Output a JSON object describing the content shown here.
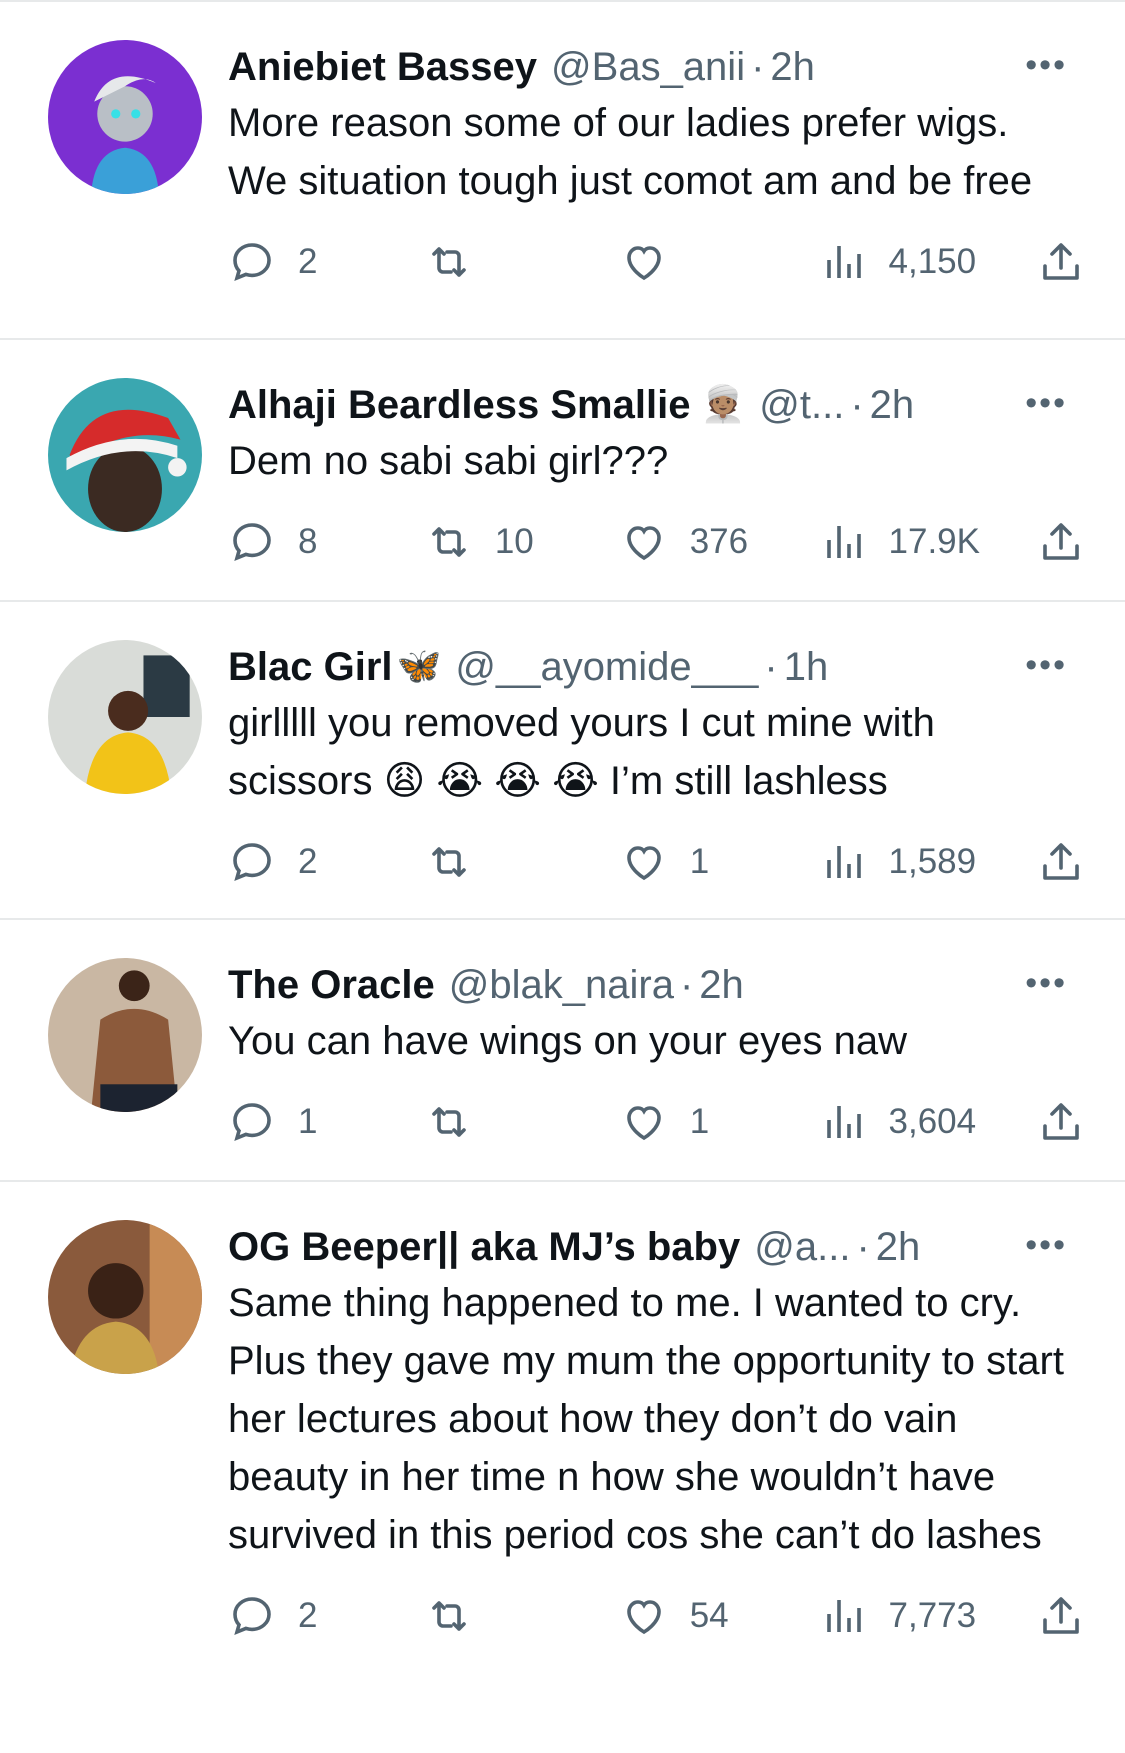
{
  "tweets": [
    {
      "name": "Aniebiet Bassey",
      "emoji": "",
      "handle": "@Bas_anii",
      "time": "2h",
      "text": "More reason some of our ladies prefer wigs. We situation tough just comot am and be free",
      "replies": "2",
      "retweets": "",
      "likes": "",
      "views": "4,150",
      "avatar_bg": "#7b2fd1"
    },
    {
      "name": "Alhaji Beardless Smallie",
      "emoji": "👳🏽",
      "handle": "@t...",
      "time": "2h",
      "text": "Dem no sabi sabi girl???",
      "replies": "8",
      "retweets": "10",
      "likes": "376",
      "views": "17.9K",
      "avatar_bg": "#3aa7b0"
    },
    {
      "name": "Blac Girl",
      "emoji": "🦋",
      "handle": "@__ayomide___",
      "time": "1h",
      "text": "girlllll you removed yours I cut mine with scissors 😩 😭 😭 😭 I’m still lashless",
      "replies": "2",
      "retweets": "",
      "likes": "1",
      "views": "1,589",
      "avatar_bg": "#c9a23a"
    },
    {
      "name": "The Oracle",
      "emoji": "",
      "handle": "@blak_naira",
      "time": "2h",
      "text": "You can have wings on your eyes naw",
      "replies": "1",
      "retweets": "",
      "likes": "1",
      "views": "3,604",
      "avatar_bg": "#8c6a4f"
    },
    {
      "name": "OG Beeper|| aka MJ’s baby",
      "emoji": "",
      "handle": "@a...",
      "time": "2h",
      "text": "Same thing happened to me. I wanted to cry. Plus they gave my mum the opportunity to start her lectures about how they don’t do vain beauty in her time n how she wouldn’t have survived in this period cos she can’t do lashes",
      "replies": "2",
      "retweets": "",
      "likes": "54",
      "views": "7,773",
      "avatar_bg": "#6b4a35"
    }
  ],
  "ui": {
    "separator": "·",
    "more": "•••"
  },
  "icons": {
    "reply": "reply-icon",
    "retweet": "retweet-icon",
    "like": "heart-icon",
    "views": "views-chart-icon",
    "share": "share-icon"
  }
}
